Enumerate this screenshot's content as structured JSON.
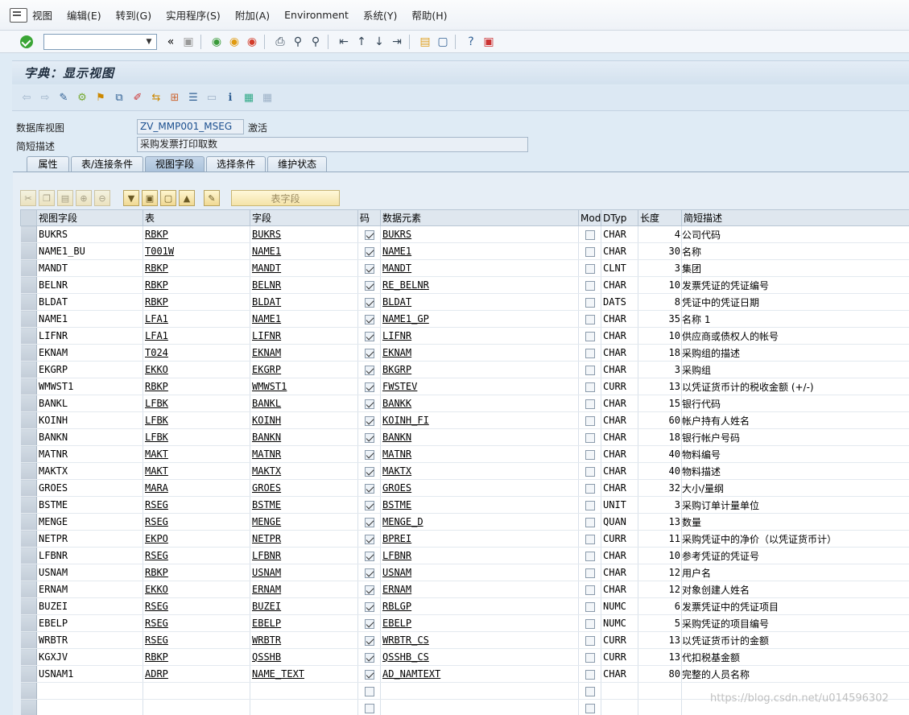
{
  "menu": [
    "视图",
    "编辑(E)",
    "转到(G)",
    "实用程序(S)",
    "附加(A)",
    "Environment",
    "系统(Y)",
    "帮助(H)"
  ],
  "title": "字典：显示视图",
  "header": {
    "view_label": "数据库视图",
    "view_name": "ZV_MMP001_MSEG",
    "status": "激活",
    "desc_label": "简短描述",
    "desc_value": "采购发票打印取数"
  },
  "tabs": [
    "属性",
    "表/连接条件",
    "视图字段",
    "选择条件",
    "维护状态"
  ],
  "active_tab": "视图字段",
  "table_fields_button": "表字段",
  "columns": [
    "视图字段",
    "表",
    "字段",
    "码",
    "数据元素",
    "Mod",
    "DTyp",
    "长度",
    "简短描述"
  ],
  "rows": [
    {
      "vf": "BUKRS",
      "tab": "RBKP",
      "fld": "BUKRS",
      "key": true,
      "de": "BUKRS",
      "mod": false,
      "dt": "CHAR",
      "len": "4",
      "desc": "公司代码"
    },
    {
      "vf": "NAME1_BU",
      "tab": "T001W",
      "fld": "NAME1",
      "key": true,
      "de": "NAME1",
      "mod": false,
      "dt": "CHAR",
      "len": "30",
      "desc": "名称"
    },
    {
      "vf": "MANDT",
      "tab": "RBKP",
      "fld": "MANDT",
      "key": true,
      "de": "MANDT",
      "mod": false,
      "dt": "CLNT",
      "len": "3",
      "desc": "集团"
    },
    {
      "vf": "BELNR",
      "tab": "RBKP",
      "fld": "BELNR",
      "key": true,
      "de": "RE_BELNR",
      "mod": false,
      "dt": "CHAR",
      "len": "10",
      "desc": "发票凭证的凭证编号"
    },
    {
      "vf": "BLDAT",
      "tab": "RBKP",
      "fld": "BLDAT",
      "key": true,
      "de": "BLDAT",
      "mod": false,
      "dt": "DATS",
      "len": "8",
      "desc": "凭证中的凭证日期"
    },
    {
      "vf": "NAME1",
      "tab": "LFA1",
      "fld": "NAME1",
      "key": true,
      "de": "NAME1_GP",
      "mod": false,
      "dt": "CHAR",
      "len": "35",
      "desc": "名称 1"
    },
    {
      "vf": "LIFNR",
      "tab": "LFA1",
      "fld": "LIFNR",
      "key": true,
      "de": "LIFNR",
      "mod": false,
      "dt": "CHAR",
      "len": "10",
      "desc": "供应商或债权人的帐号"
    },
    {
      "vf": "EKNAM",
      "tab": "T024",
      "fld": "EKNAM",
      "key": true,
      "de": "EKNAM",
      "mod": false,
      "dt": "CHAR",
      "len": "18",
      "desc": "采购组的描述"
    },
    {
      "vf": "EKGRP",
      "tab": "EKKO",
      "fld": "EKGRP",
      "key": true,
      "de": "BKGRP",
      "mod": false,
      "dt": "CHAR",
      "len": "3",
      "desc": "采购组"
    },
    {
      "vf": "WMWST1",
      "tab": "RBKP",
      "fld": "WMWST1",
      "key": true,
      "de": "FWSTEV",
      "mod": false,
      "dt": "CURR",
      "len": "13",
      "desc": "以凭证货币计的税收金额 (+/-)"
    },
    {
      "vf": "BANKL",
      "tab": "LFBK",
      "fld": "BANKL",
      "key": true,
      "de": "BANKK",
      "mod": false,
      "dt": "CHAR",
      "len": "15",
      "desc": "银行代码"
    },
    {
      "vf": "KOINH",
      "tab": "LFBK",
      "fld": "KOINH",
      "key": true,
      "de": "KOINH_FI",
      "mod": false,
      "dt": "CHAR",
      "len": "60",
      "desc": "帐户持有人姓名"
    },
    {
      "vf": "BANKN",
      "tab": "LFBK",
      "fld": "BANKN",
      "key": true,
      "de": "BANKN",
      "mod": false,
      "dt": "CHAR",
      "len": "18",
      "desc": "银行帐户号码"
    },
    {
      "vf": "MATNR",
      "tab": "MAKT",
      "fld": "MATNR",
      "key": true,
      "de": "MATNR",
      "mod": false,
      "dt": "CHAR",
      "len": "40",
      "desc": "物料编号"
    },
    {
      "vf": "MAKTX",
      "tab": "MAKT",
      "fld": "MAKTX",
      "key": true,
      "de": "MAKTX",
      "mod": false,
      "dt": "CHAR",
      "len": "40",
      "desc": "物料描述"
    },
    {
      "vf": "GROES",
      "tab": "MARA",
      "fld": "GROES",
      "key": true,
      "de": "GROES",
      "mod": false,
      "dt": "CHAR",
      "len": "32",
      "desc": "大小/量纲"
    },
    {
      "vf": "BSTME",
      "tab": "RSEG",
      "fld": "BSTME",
      "key": true,
      "de": "BSTME",
      "mod": false,
      "dt": "UNIT",
      "len": "3",
      "desc": "采购订单计量单位"
    },
    {
      "vf": "MENGE",
      "tab": "RSEG",
      "fld": "MENGE",
      "key": true,
      "de": "MENGE_D",
      "mod": false,
      "dt": "QUAN",
      "len": "13",
      "desc": "数量"
    },
    {
      "vf": "NETPR",
      "tab": "EKPO",
      "fld": "NETPR",
      "key": true,
      "de": "BPREI",
      "mod": false,
      "dt": "CURR",
      "len": "11",
      "desc": "采购凭证中的净价（以凭证货币计）"
    },
    {
      "vf": "LFBNR",
      "tab": "RSEG",
      "fld": "LFBNR",
      "key": true,
      "de": "LFBNR",
      "mod": false,
      "dt": "CHAR",
      "len": "10",
      "desc": "参考凭证的凭证号"
    },
    {
      "vf": "USNAM",
      "tab": "RBKP",
      "fld": "USNAM",
      "key": true,
      "de": "USNAM",
      "mod": false,
      "dt": "CHAR",
      "len": "12",
      "desc": "用户名"
    },
    {
      "vf": "ERNAM",
      "tab": "EKKO",
      "fld": "ERNAM",
      "key": true,
      "de": "ERNAM",
      "mod": false,
      "dt": "CHAR",
      "len": "12",
      "desc": "对象创建人姓名"
    },
    {
      "vf": "BUZEI",
      "tab": "RSEG",
      "fld": "BUZEI",
      "key": true,
      "de": "RBLGP",
      "mod": false,
      "dt": "NUMC",
      "len": "6",
      "desc": "发票凭证中的凭证项目"
    },
    {
      "vf": "EBELP",
      "tab": "RSEG",
      "fld": "EBELP",
      "key": true,
      "de": "EBELP",
      "mod": false,
      "dt": "NUMC",
      "len": "5",
      "desc": "采购凭证的项目编号"
    },
    {
      "vf": "WRBTR",
      "tab": "RSEG",
      "fld": "WRBTR",
      "key": true,
      "de": "WRBTR_CS",
      "mod": false,
      "dt": "CURR",
      "len": "13",
      "desc": "以凭证货币计的金额"
    },
    {
      "vf": "KGXJV",
      "tab": "RBKP",
      "fld": "QSSHB",
      "key": true,
      "de": "QSSHB_CS",
      "mod": false,
      "dt": "CURR",
      "len": "13",
      "desc": "代扣税基金额"
    },
    {
      "vf": "USNAM1",
      "tab": "ADRP",
      "fld": "NAME_TEXT",
      "key": true,
      "de": "AD_NAMTEXT",
      "mod": false,
      "dt": "CHAR",
      "len": "80",
      "desc": "完整的人员名称"
    }
  ],
  "empty_rows": 2,
  "watermark": "https://blog.csdn.net/u014596302",
  "colors": {
    "accent": "#2f5f93",
    "key_check": "#333333",
    "ok_green": "#3aa535"
  }
}
